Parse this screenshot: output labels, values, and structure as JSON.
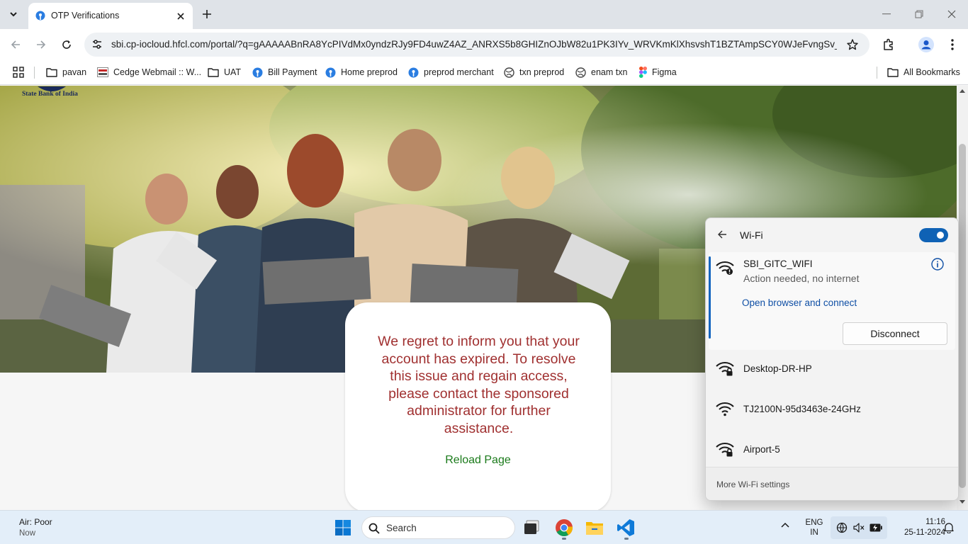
{
  "browser": {
    "tab_title": "OTP Verifications",
    "url": "sbi.cp-iocloud.hfcl.com/portal/?q=gAAAAABnRA8YcPIVdMx0yndzRJy9FD4uwZ4AZ_ANRXS5b8GHIZnOJbW82u1PK3IYv_WRVKmKlXhsvshT1BZTAmpSCY0WJeFvngSv_...",
    "bookmarks": [
      {
        "label": "pavan",
        "icon": "folder-icon"
      },
      {
        "label": "Cedge Webmail :: W...",
        "icon": "cedge-icon"
      },
      {
        "label": "UAT",
        "icon": "folder-icon"
      },
      {
        "label": "Bill Payment",
        "icon": "pin-icon"
      },
      {
        "label": "Home preprod",
        "icon": "pin-icon"
      },
      {
        "label": "preprod merchant",
        "icon": "pin-icon"
      },
      {
        "label": "txn preprod",
        "icon": "globe-icon"
      },
      {
        "label": "enam txn",
        "icon": "globe-icon"
      },
      {
        "label": "Figma",
        "icon": "figma-icon"
      }
    ],
    "all_bookmarks": "All Bookmarks"
  },
  "page": {
    "logo_text": "State Bank of India",
    "message": "We regret to inform you that your account has expired. To resolve this issue and regain access, please contact the sponsored administrator for further assistance.",
    "reload": "Reload Page",
    "colors": {
      "message": "#a03030",
      "reload": "#1a7a1a"
    }
  },
  "wifi": {
    "title": "Wi-Fi",
    "enabled": true,
    "connected": {
      "name": "SBI_GITC_WIFI",
      "status": "Action needed, no internet",
      "action": "Open browser and connect",
      "disconnect": "Disconnect"
    },
    "networks": [
      {
        "name": "Desktop-DR-HP",
        "secured": true
      },
      {
        "name": "TJ2100N-95d3463e-24GHz",
        "secured": false
      },
      {
        "name": "Airport-5",
        "secured": true
      }
    ],
    "more_settings": "More Wi-Fi settings",
    "accent": "#0f62b5"
  },
  "taskbar": {
    "weather_title": "Air: Poor",
    "weather_sub": "Now",
    "search_label": "Search",
    "lang_line1": "ENG",
    "lang_line2": "IN",
    "time": "11:16",
    "date": "25-11-2024"
  }
}
